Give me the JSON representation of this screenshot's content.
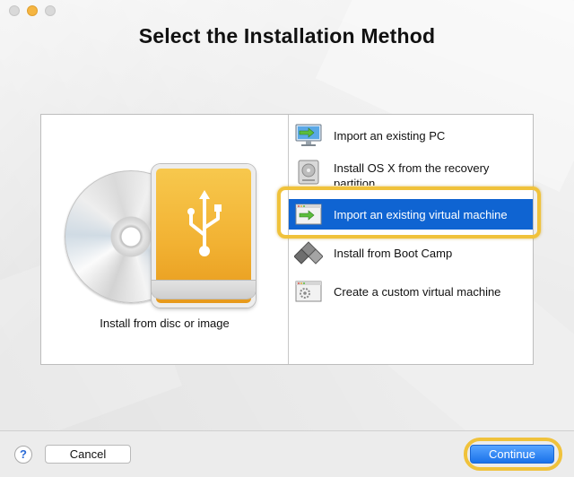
{
  "window": {
    "title": "Select the Installation Method"
  },
  "left_pane": {
    "caption": "Install from disc or image"
  },
  "methods": [
    {
      "label": "Import an existing PC",
      "icon": "pc-import-icon",
      "selected": false
    },
    {
      "label": "Install OS X from the recovery partition",
      "icon": "hard-drive-icon",
      "selected": false
    },
    {
      "label": "Import an existing virtual machine",
      "icon": "vm-import-icon",
      "selected": true
    },
    {
      "label": "Install from Boot Camp",
      "icon": "boot-camp-icon",
      "selected": false
    },
    {
      "label": "Create a custom virtual machine",
      "icon": "custom-vm-icon",
      "selected": false
    }
  ],
  "footer": {
    "help_label": "?",
    "cancel_label": "Cancel",
    "continue_label": "Continue"
  },
  "colors": {
    "selection": "#0f64d2",
    "highlight_ring": "#f0c23b",
    "continue_button": "#1a72ea"
  }
}
